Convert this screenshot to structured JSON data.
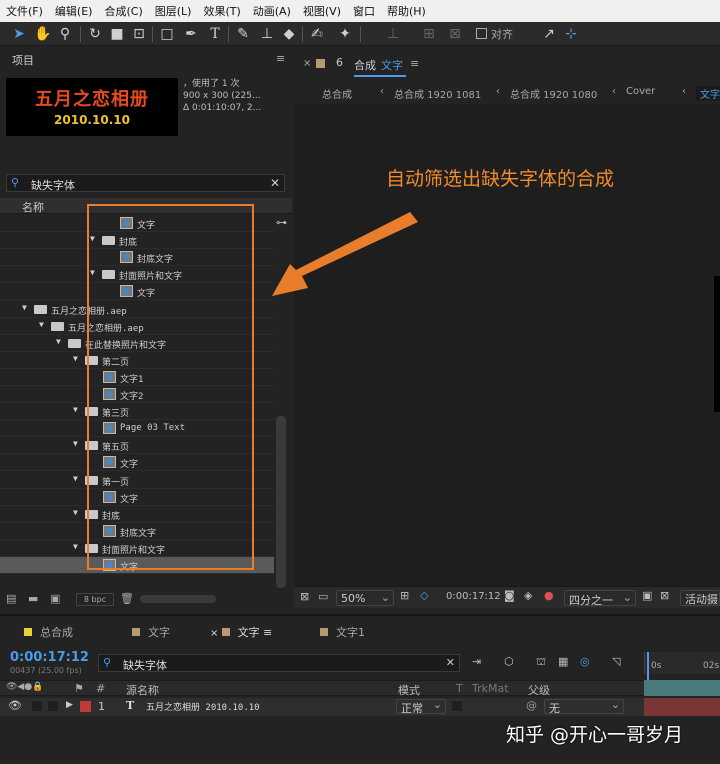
{
  "menubar": [
    "文件(F)",
    "编辑(E)",
    "合成(C)",
    "图层(L)",
    "效果(T)",
    "动画(A)",
    "视图(V)",
    "窗口",
    "帮助(H)"
  ],
  "toolbar": {
    "align_label": "对齐"
  },
  "project": {
    "title": "项目",
    "thumb_title": "五月之恋相册",
    "thumb_date": "2010.10.10",
    "info_used": "，使用了 1 次",
    "info_size": "900 x 300 (225...",
    "info_duration": "Δ 0:01:10:07, 2...",
    "search_value": "缺失字体",
    "col_name": "名称",
    "rows": [
      {
        "indent": 118,
        "type": "comp",
        "label": "文字",
        "tri": ""
      },
      {
        "indent": 100,
        "type": "folder",
        "label": "封底",
        "tri": "▼"
      },
      {
        "indent": 118,
        "type": "comp",
        "label": "封底文字",
        "tri": ""
      },
      {
        "indent": 100,
        "type": "folder",
        "label": "封面照片和文字",
        "tri": "▼"
      },
      {
        "indent": 118,
        "type": "comp",
        "label": "文字",
        "tri": ""
      },
      {
        "indent": 32,
        "type": "folder",
        "label": "五月之恋相册.aep",
        "tri": "▼"
      },
      {
        "indent": 49,
        "type": "folder",
        "label": "五月之恋相册.aep",
        "tri": "▼"
      },
      {
        "indent": 66,
        "type": "folder",
        "label": "在此替换照片和文字",
        "tri": "▼"
      },
      {
        "indent": 83,
        "type": "folder",
        "label": "第二页",
        "tri": "▼"
      },
      {
        "indent": 101,
        "type": "comp",
        "label": "文字1",
        "tri": ""
      },
      {
        "indent": 101,
        "type": "comp",
        "label": "文字2",
        "tri": ""
      },
      {
        "indent": 83,
        "type": "folder",
        "label": "第三页",
        "tri": "▼"
      },
      {
        "indent": 101,
        "type": "comp",
        "label": "Page 03 Text",
        "tri": ""
      },
      {
        "indent": 83,
        "type": "folder",
        "label": "第五页",
        "tri": "▼"
      },
      {
        "indent": 101,
        "type": "comp",
        "label": "文字",
        "tri": ""
      },
      {
        "indent": 83,
        "type": "folder",
        "label": "第一页",
        "tri": "▼"
      },
      {
        "indent": 101,
        "type": "comp",
        "label": "文字",
        "tri": ""
      },
      {
        "indent": 83,
        "type": "folder",
        "label": "封底",
        "tri": "▼"
      },
      {
        "indent": 101,
        "type": "comp",
        "label": "封底文字",
        "tri": ""
      },
      {
        "indent": 83,
        "type": "folder",
        "label": "封面照片和文字",
        "tri": "▼"
      },
      {
        "indent": 101,
        "type": "comp",
        "label": "文字",
        "tri": "",
        "selected": true
      }
    ],
    "bpc": "8 bpc"
  },
  "viewer": {
    "tab_label": "合成",
    "tab_name": "文字",
    "crumbs": [
      "总合成",
      "总合成 1920 1081",
      "总合成 1920 1080",
      "Cover",
      "文字"
    ],
    "annotation": "自动筛选出缺失字体的合成",
    "zoom": "50%",
    "time": "0:00:17:12",
    "resolution": "四分之一",
    "active_cam": "活动摄"
  },
  "timeline": {
    "tabs": [
      {
        "label": "总合成",
        "color": "#e6d33a"
      },
      {
        "label": "文字",
        "color": "#b59a72"
      },
      {
        "label": "文字",
        "color": "#b59a72",
        "active": true
      },
      {
        "label": "文字1",
        "color": "#b59a72"
      }
    ],
    "timecode": "0:00:17:12",
    "frames": "00437 (25.00 fps)",
    "search_value": "缺失字体",
    "col_source": "源名称",
    "col_mode": "模式",
    "col_t": "T",
    "col_trkmat": "TrkMat",
    "col_parent": "父级",
    "layer": {
      "num": "1",
      "name": "五月之恋相册 2010.10.10",
      "mode": "正常",
      "parent": "无",
      "label_color": "#c23b3b"
    },
    "ruler": [
      "0s",
      "02s"
    ]
  },
  "watermark": "知乎 @开心一哥岁月"
}
